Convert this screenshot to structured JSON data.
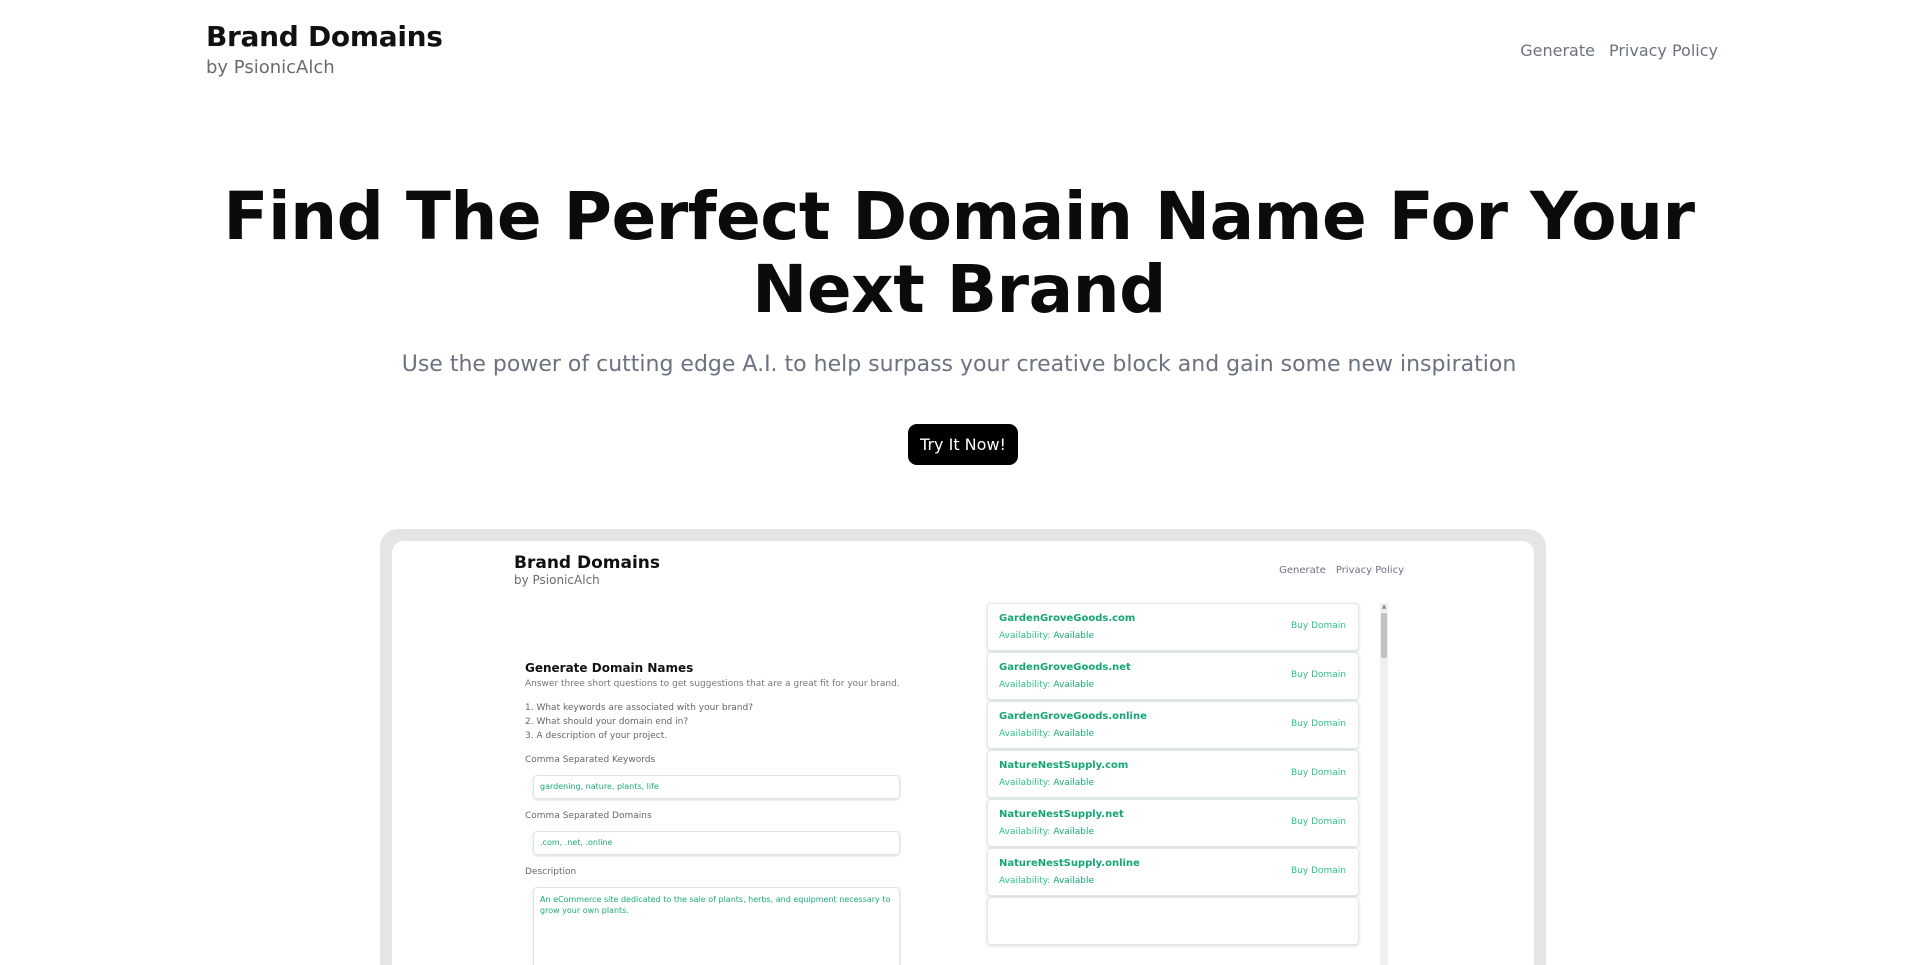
{
  "header": {
    "title": "Brand Domains",
    "subtitle": "by PsionicAlch",
    "nav": [
      "Generate",
      "Privacy Policy"
    ]
  },
  "hero": {
    "title_line1": "Find The Perfect Domain Name For Your",
    "title_line2": "Next Brand",
    "subtitle": "Use the power of cutting edge A.I. to help surpass your creative block and gain some new inspiration",
    "cta": "Try It Now!"
  },
  "mockup": {
    "header": {
      "title": "Brand Domains",
      "subtitle": "by PsionicAlch",
      "nav": [
        "Generate",
        "Privacy Policy"
      ]
    },
    "form": {
      "title": "Generate Domain Names",
      "intro": "Answer three short questions to get suggestions that are a great fit for your brand.",
      "steps": [
        "1. What keywords are associated with your brand?",
        "2. What should your domain end in?",
        "3. A description of your project."
      ],
      "keywords_label": "Comma Separated Keywords",
      "keywords_value": "gardening, nature, plants, life",
      "domains_label": "Comma Separated Domains",
      "domains_value": ".com, .net, .online",
      "description_label": "Description",
      "description_value": "An eCommerce site dedicated to the sale of plants, herbs, and equipment necessary to grow your own plants."
    },
    "results": [
      {
        "domain": "GardenGroveGoods.com",
        "availability_label": "Availability:",
        "status": "Available",
        "buy": "Buy Domain"
      },
      {
        "domain": "GardenGroveGoods.net",
        "availability_label": "Availability:",
        "status": "Available",
        "buy": "Buy Domain"
      },
      {
        "domain": "GardenGroveGoods.online",
        "availability_label": "Availability:",
        "status": "Available",
        "buy": "Buy Domain"
      },
      {
        "domain": "NatureNestSupply.com",
        "availability_label": "Availability:",
        "status": "Available",
        "buy": "Buy Domain"
      },
      {
        "domain": "NatureNestSupply.net",
        "availability_label": "Availability:",
        "status": "Available",
        "buy": "Buy Domain"
      },
      {
        "domain": "NatureNestSupply.online",
        "availability_label": "Availability:",
        "status": "Available",
        "buy": "Buy Domain"
      }
    ],
    "colors": {
      "accent": "#16a673"
    }
  }
}
